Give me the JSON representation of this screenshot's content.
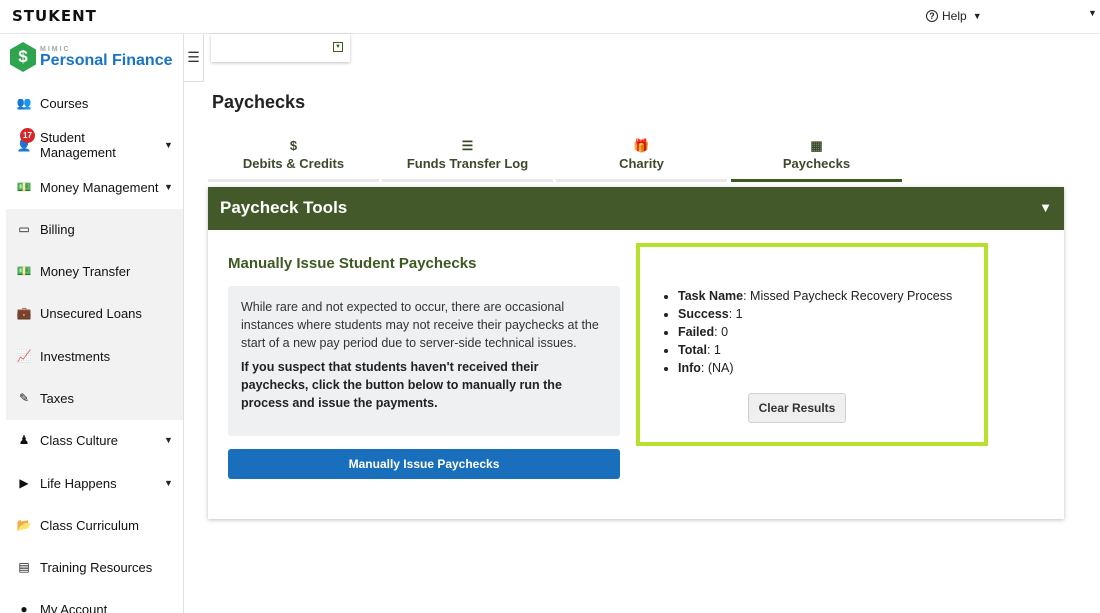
{
  "topbar": {
    "brand": "STUKENT",
    "help_label": "Help"
  },
  "logo": {
    "sub": "MIMIC",
    "name": "Personal Finance",
    "symbol": "$"
  },
  "sidebar": {
    "items": [
      {
        "label": "Courses",
        "icon": "users-icon",
        "glyph": "👥",
        "dropdown": false
      },
      {
        "label": "Student Management",
        "icon": "user-icon",
        "glyph": "👤",
        "dropdown": true,
        "badge": "17"
      },
      {
        "label": "Money Management",
        "icon": "money-icon",
        "glyph": "💵",
        "dropdown": true
      },
      {
        "label": "Billing",
        "icon": "credit-card-icon",
        "glyph": "▭",
        "dropdown": false
      },
      {
        "label": "Money Transfer",
        "icon": "money-transfer-icon",
        "glyph": "💵",
        "dropdown": false
      },
      {
        "label": "Unsecured Loans",
        "icon": "briefcase-icon",
        "glyph": "💼",
        "dropdown": false
      },
      {
        "label": "Investments",
        "icon": "chart-line-icon",
        "glyph": "📈",
        "dropdown": false
      },
      {
        "label": "Taxes",
        "icon": "edit-icon",
        "glyph": "✎",
        "dropdown": false
      },
      {
        "label": "Class Culture",
        "icon": "trophy-icon",
        "glyph": "♟",
        "dropdown": true
      },
      {
        "label": "Life Happens",
        "icon": "play-circle-icon",
        "glyph": "▶",
        "dropdown": true
      },
      {
        "label": "Class Curriculum",
        "icon": "folder-open-icon",
        "glyph": "📂",
        "dropdown": false
      },
      {
        "label": "Training Resources",
        "icon": "file-icon",
        "glyph": "▤",
        "dropdown": false
      },
      {
        "label": "My Account",
        "icon": "account-icon",
        "glyph": "●",
        "dropdown": false
      }
    ]
  },
  "main": {
    "page_title": "Paychecks",
    "tabs": [
      {
        "label": "Debits & Credits",
        "icon": "dollar-icon",
        "glyph": "$",
        "active": false
      },
      {
        "label": "Funds Transfer Log",
        "icon": "list-icon",
        "glyph": "☰",
        "active": false
      },
      {
        "label": "Charity",
        "icon": "gift-icon",
        "glyph": "🎁",
        "active": false
      },
      {
        "label": "Paychecks",
        "icon": "newspaper-icon",
        "glyph": "▦",
        "active": true
      }
    ],
    "panel": {
      "title": "Paycheck Tools",
      "section_title": "Manually Issue Student Paychecks",
      "note_text": "While rare and not expected to occur, there are occasional instances where students may not receive their paychecks at the start of a new pay period due to server-side technical issues.",
      "note_strong": "If you suspect that students haven't received their paychecks, click the button below to manually run the process and issue the payments.",
      "issue_button": "Manually Issue Paychecks",
      "results": {
        "task_name_label": "Task Name",
        "task_name_value": ": Missed Paycheck Recovery Process",
        "success_label": "Success",
        "success_value": ": 1",
        "failed_label": "Failed",
        "failed_value": ": 0",
        "total_label": "Total",
        "total_value": ": 1",
        "info_label": "Info",
        "info_value": ": (NA)",
        "clear_button": "Clear Results"
      }
    }
  },
  "colors": {
    "panel_header": "#44592a",
    "primary_button": "#1a6fbd",
    "highlight_border": "#b6e02c",
    "logo_green": "#2ea44f",
    "logo_blue": "#1a73c7",
    "badge_red": "#d62828"
  }
}
